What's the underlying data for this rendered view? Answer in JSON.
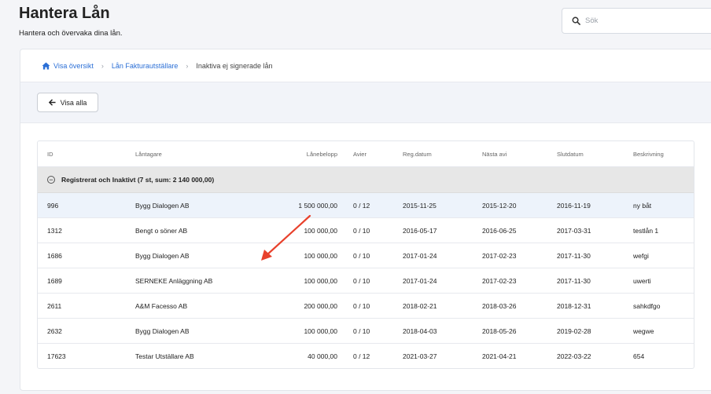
{
  "header": {
    "title": "Hantera Lån",
    "subtitle": "Hantera och övervaka dina lån."
  },
  "search": {
    "placeholder": "Sök",
    "value": ""
  },
  "breadcrumb": {
    "items": [
      "Visa översikt",
      "Lån Fakturautställare"
    ],
    "current": "Inaktiva ej signerade lån"
  },
  "toolbar": {
    "back_label": "Visa alla"
  },
  "table": {
    "columns": {
      "id": "ID",
      "borrower": "Låntagare",
      "amount": "Lånebelopp",
      "avier": "Avier",
      "reg_date": "Reg.datum",
      "next_notice": "Nästa avi",
      "end_date": "Slutdatum",
      "description": "Beskrivning"
    },
    "group": {
      "toggle": "−",
      "label": "Registrerat och Inaktivt (7 st, sum: 2 140 000,00)"
    },
    "rows": [
      {
        "id": "996",
        "borrower": "Bygg Dialogen AB",
        "amount": "1 500 000,00",
        "avier": "0 / 12",
        "reg_date": "2015-11-25",
        "next_notice": "2015-12-20",
        "end_date": "2016-11-19",
        "description": "ny båt"
      },
      {
        "id": "1312",
        "borrower": "Bengt o söner AB",
        "amount": "100 000,00",
        "avier": "0 / 10",
        "reg_date": "2016-05-17",
        "next_notice": "2016-06-25",
        "end_date": "2017-03-31",
        "description": "testlån 1"
      },
      {
        "id": "1686",
        "borrower": "Bygg Dialogen AB",
        "amount": "100 000,00",
        "avier": "0 / 10",
        "reg_date": "2017-01-24",
        "next_notice": "2017-02-23",
        "end_date": "2017-11-30",
        "description": "wefgi"
      },
      {
        "id": "1689",
        "borrower": "SERNEKE Anläggning AB",
        "amount": "100 000,00",
        "avier": "0 / 10",
        "reg_date": "2017-01-24",
        "next_notice": "2017-02-23",
        "end_date": "2017-11-30",
        "description": "uwerti"
      },
      {
        "id": "2611",
        "borrower": "A&M Facesso AB",
        "amount": "200 000,00",
        "avier": "0 / 10",
        "reg_date": "2018-02-21",
        "next_notice": "2018-03-26",
        "end_date": "2018-12-31",
        "description": "sahkdfgo"
      },
      {
        "id": "2632",
        "borrower": "Bygg Dialogen AB",
        "amount": "100 000,00",
        "avier": "0 / 10",
        "reg_date": "2018-04-03",
        "next_notice": "2018-05-26",
        "end_date": "2019-02-28",
        "description": "wegwe"
      },
      {
        "id": "17623",
        "borrower": "Testar Utställare AB",
        "amount": "40 000,00",
        "avier": "0 / 12",
        "reg_date": "2021-03-27",
        "next_notice": "2021-04-21",
        "end_date": "2022-03-22",
        "description": "654"
      }
    ]
  },
  "colors": {
    "link": "#2b6fd6",
    "annotation_arrow": "#e8412c",
    "highlight_row": "#edf3fb",
    "group_row": "#e7e7e7"
  },
  "icons": {
    "search": "search-icon",
    "home": "home-icon",
    "back": "arrow-left-icon",
    "annotation": "annotation-arrow-icon"
  }
}
